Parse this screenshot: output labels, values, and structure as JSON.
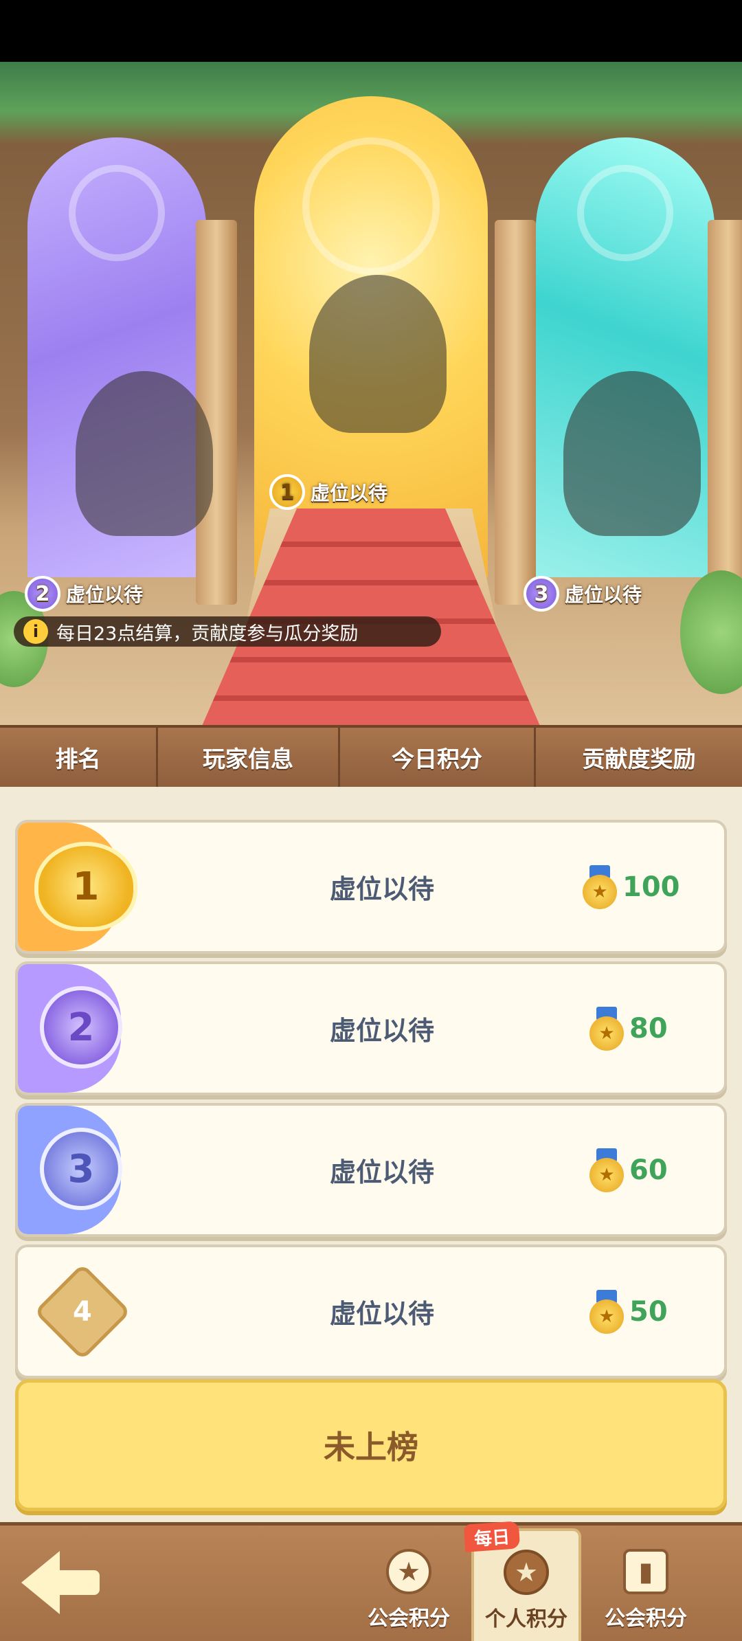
{
  "notice": {
    "text": "每日23点结算，贡献度参与瓜分奖励",
    "icon": "info-icon"
  },
  "podium": {
    "first": {
      "rank": "1",
      "name": "虚位以待"
    },
    "second": {
      "rank": "2",
      "name": "虚位以待"
    },
    "third": {
      "rank": "3",
      "name": "虚位以待"
    }
  },
  "table_headers": [
    "排名",
    "玩家信息",
    "今日积分",
    "贡献度奖励"
  ],
  "rows": [
    {
      "rank": "1",
      "name": "虚位以待",
      "reward": "100",
      "accent": "#ffb547"
    },
    {
      "rank": "2",
      "name": "虚位以待",
      "reward": "80",
      "accent": "#b79aff"
    },
    {
      "rank": "3",
      "name": "虚位以待",
      "reward": "60",
      "accent": "#8fa2ff"
    },
    {
      "rank": "4",
      "name": "虚位以待",
      "reward": "50",
      "accent": ""
    }
  ],
  "unranked_label": "未上榜",
  "bottom_nav": {
    "tabs": [
      {
        "label": "公会积分",
        "icon": "star-ribbon-icon"
      },
      {
        "label": "个人积分",
        "icon": "star-icon",
        "active": true,
        "tag": "每日"
      },
      {
        "label": "公会积分",
        "icon": "bar-chart-icon"
      }
    ]
  },
  "colors": {
    "reward_green": "#3fa45a",
    "name_text": "#4d5a73",
    "unranked_bg": "#ffe37a"
  }
}
